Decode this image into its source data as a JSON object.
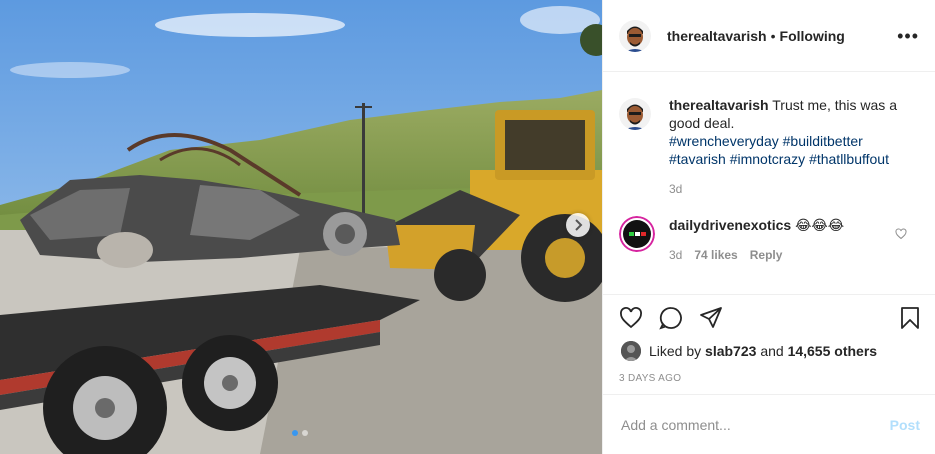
{
  "header": {
    "username": "therealtavarish",
    "separator": "•",
    "follow_status": "Following",
    "more_icon": "more-horizontal-icon"
  },
  "caption": {
    "username": "therealtavarish",
    "text": "Trust me, this was a good deal.",
    "hashtags": [
      "#wrencheveryday",
      "#builditbetter",
      "#tavarish",
      "#imnotcrazy",
      "#thatllbuffout"
    ],
    "age": "3d"
  },
  "comment": {
    "username": "dailydrivenexotics",
    "text": "😂😂😂",
    "age": "3d",
    "likes": "74 likes",
    "reply_label": "Reply"
  },
  "likes": {
    "prefix": "Liked by",
    "user": "slab723",
    "conj": "and",
    "count": "14,655 others"
  },
  "date": "3 DAYS AGO",
  "add_comment": {
    "placeholder": "Add a comment...",
    "post_label": "Post"
  },
  "colors": {
    "link": "#003569",
    "muted": "#8e8e8e",
    "post_disabled": "#b2dffc",
    "carousel_active": "#3897f0"
  },
  "carousel": {
    "current": 1,
    "total": 2
  }
}
